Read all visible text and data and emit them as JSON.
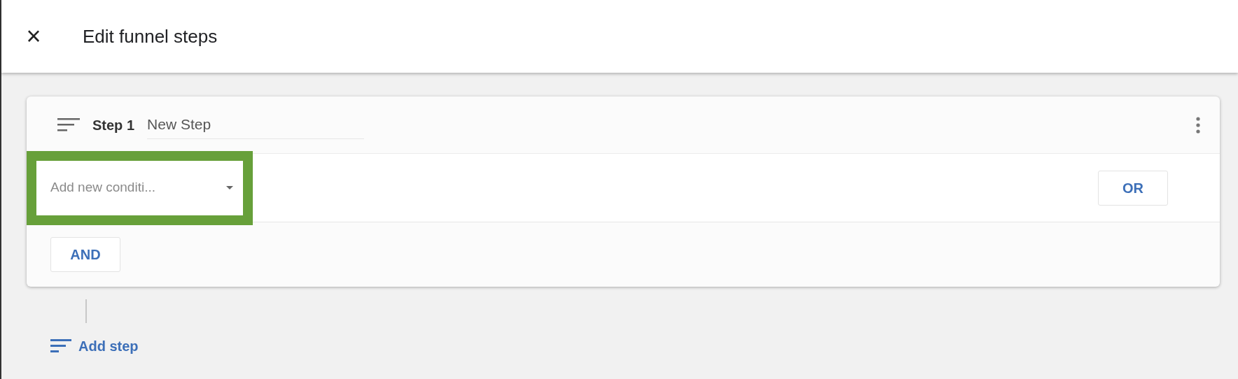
{
  "header": {
    "close_icon": "×",
    "title": "Edit funnel steps"
  },
  "steps": [
    {
      "label": "Step 1",
      "name": "New Step",
      "condition": {
        "placeholder": "Add new conditi...",
        "highlighted": true
      },
      "or_button": "OR",
      "and_button": "AND"
    }
  ],
  "add_step": "Add step"
}
